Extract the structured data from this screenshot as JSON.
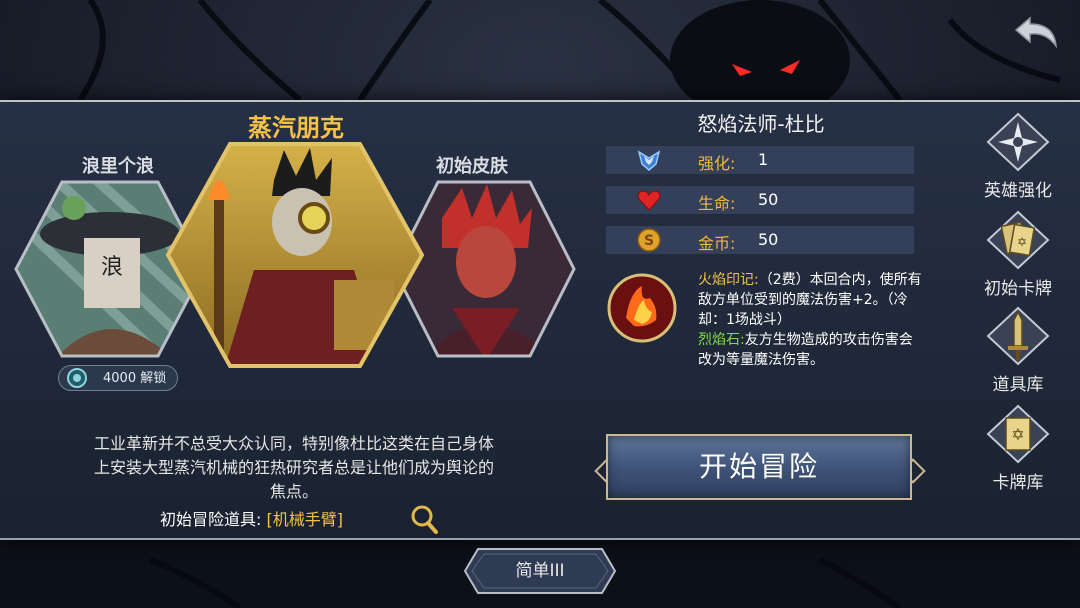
{
  "skins": {
    "left": {
      "name": "浪里个浪",
      "unlock_cost": "4000 解锁"
    },
    "center": {
      "name": "蒸汽朋克"
    },
    "right": {
      "name": "初始皮肤"
    }
  },
  "hero": {
    "name": "怒焰法师-杜比",
    "stats": [
      {
        "label": "强化:",
        "value": "1",
        "icon": "blue-rank-icon"
      },
      {
        "label": "生命:",
        "value": "50",
        "icon": "heart-icon"
      },
      {
        "label": "金币:",
        "value": "50",
        "icon": "gold-coin-icon"
      }
    ],
    "skills": [
      {
        "name": "火焰印记:",
        "text": "（2费）本回合内，使所有敌方单位受到的魔法伤害+2。（冷却：1场战斗）"
      },
      {
        "name": "烈焰石:",
        "text": "友方生物造成的攻击伤害会改为等量魔法伤害。"
      }
    ]
  },
  "description": "工业革新并不总受大众认同，特别像杜比这类在自己身体上安装大型蒸汽机械的狂热研究者总是让他们成为舆论的焦点。",
  "starting_item": {
    "label": "初始冒险道具:",
    "name": "[机械手臂]"
  },
  "start_button": "开始冒险",
  "sidebar": [
    {
      "label": "英雄强化",
      "icon": "compass-star-icon"
    },
    {
      "label": "初始卡牌",
      "icon": "cards-icon"
    },
    {
      "label": "道具库",
      "icon": "sword-icon"
    },
    {
      "label": "卡牌库",
      "icon": "star-card-icon"
    }
  ],
  "difficulty": "简单III",
  "colors": {
    "accent_gold": "#f4c248",
    "skill_green": "#7fdc4e",
    "panel_bg": "#263044",
    "button_blue": "#3e5277"
  }
}
